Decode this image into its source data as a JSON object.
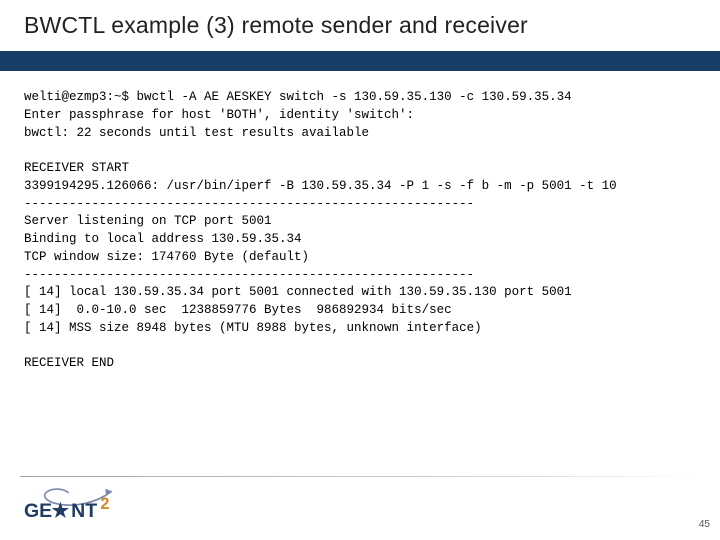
{
  "title": "BWCTL example (3) remote sender and receiver",
  "terminal": {
    "l01": "welti@ezmp3:~$ bwctl -A AE AESKEY switch -s 130.59.35.130 -c 130.59.35.34",
    "l02": "Enter passphrase for host 'BOTH', identity 'switch':",
    "l03": "bwctl: 22 seconds until test results available",
    "l04": "",
    "l05": "RECEIVER START",
    "l06": "3399194295.126066: /usr/bin/iperf -B 130.59.35.34 -P 1 -s -f b -m -p 5001 -t 10",
    "l07": "------------------------------------------------------------",
    "l08": "Server listening on TCP port 5001",
    "l09": "Binding to local address 130.59.35.34",
    "l10": "TCP window size: 174760 Byte (default)",
    "l11": "------------------------------------------------------------",
    "l12": "[ 14] local 130.59.35.34 port 5001 connected with 130.59.35.130 port 5001",
    "l13": "[ 14]  0.0-10.0 sec  1238859776 Bytes  986892934 bits/sec",
    "l14": "[ 14] MSS size 8948 bytes (MTU 8988 bytes, unknown interface)",
    "l15": "",
    "l16": "RECEIVER END"
  },
  "footer": {
    "logo_text_main": "GE",
    "logo_text_main2": "NT",
    "logo_text_sup": "2",
    "page": "45"
  }
}
